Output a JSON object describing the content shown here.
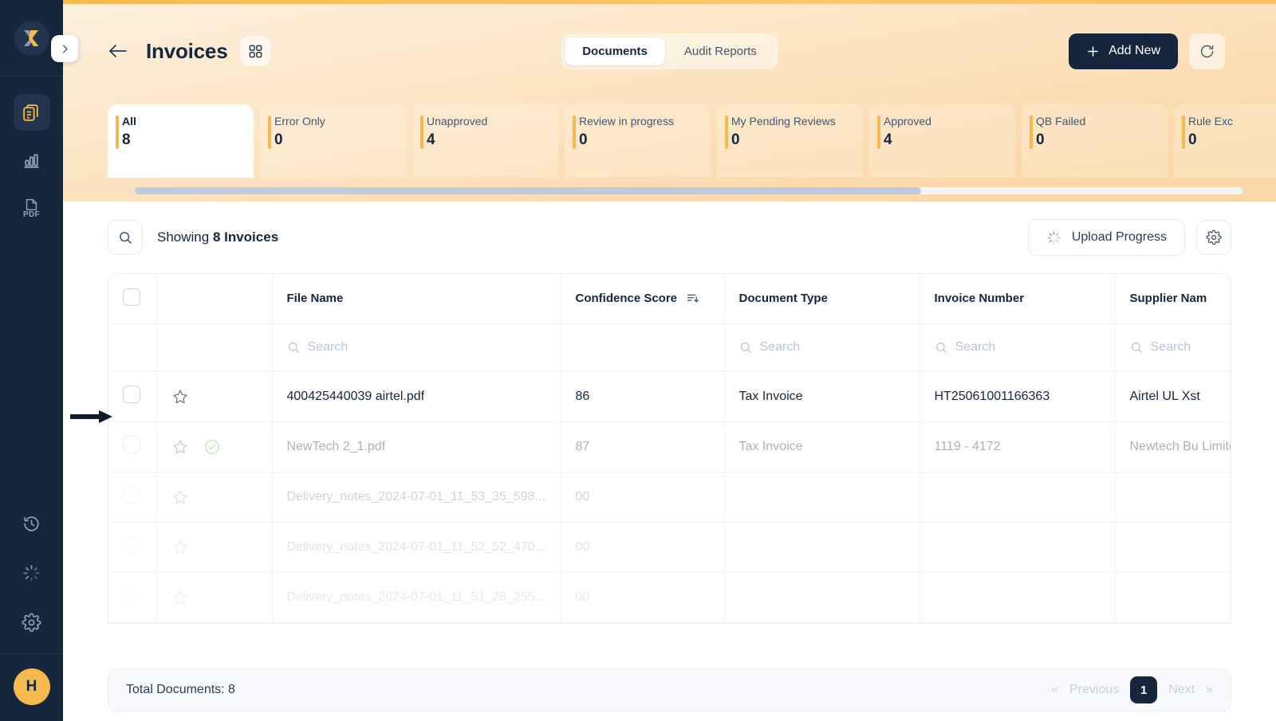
{
  "sidebar": {
    "logo_icon": "x-logo-icon",
    "collapse_icon": "chevron-right-icon",
    "items": [
      {
        "icon": "documents-icon",
        "name": "documents",
        "active": true
      },
      {
        "icon": "bar-chart-icon",
        "name": "analytics",
        "active": false
      },
      {
        "icon": "pdf-file-icon",
        "name": "pdf",
        "active": false,
        "label": "PDF"
      }
    ],
    "bottom_items": [
      {
        "icon": "history-clock-icon",
        "name": "history"
      },
      {
        "icon": "spinner-icon",
        "name": "processing"
      },
      {
        "icon": "gear-icon",
        "name": "settings"
      }
    ],
    "avatar_initial": "H"
  },
  "header": {
    "back_icon": "arrow-left-icon",
    "title": "Invoices",
    "grid_icon": "grid-view-icon",
    "tabs": [
      {
        "label": "Documents",
        "active": true
      },
      {
        "label": "Audit Reports",
        "active": false
      }
    ],
    "add_new_label": "Add New",
    "add_icon": "plus-icon",
    "refresh_icon": "refresh-icon"
  },
  "stats": [
    {
      "label": "All",
      "value": "8",
      "active": true
    },
    {
      "label": "Error Only",
      "value": "0",
      "active": false
    },
    {
      "label": "Unapproved",
      "value": "4",
      "active": false
    },
    {
      "label": "Review in progress",
      "value": "0",
      "active": false
    },
    {
      "label": "My Pending Reviews",
      "value": "0",
      "active": false
    },
    {
      "label": "Approved",
      "value": "4",
      "active": false
    },
    {
      "label": "QB Failed",
      "value": "0",
      "active": false
    },
    {
      "label": "Rule Exc",
      "value": "0",
      "active": false
    }
  ],
  "toolbar": {
    "search_icon": "search-icon",
    "showing_prefix": "Showing ",
    "showing_count": "8 Invoices",
    "upload_progress_label": "Upload Progress",
    "upload_icon": "spinner-icon",
    "settings_icon": "gear-icon"
  },
  "table": {
    "columns": [
      {
        "key": "checkbox",
        "label": ""
      },
      {
        "key": "star",
        "label": ""
      },
      {
        "key": "file_name",
        "label": "File Name",
        "searchable": true
      },
      {
        "key": "confidence_score",
        "label": "Confidence Score",
        "sortable": true,
        "searchable": false
      },
      {
        "key": "document_type",
        "label": "Document Type",
        "searchable": true
      },
      {
        "key": "invoice_number",
        "label": "Invoice Number",
        "searchable": true
      },
      {
        "key": "supplier_name",
        "label": "Supplier Nam",
        "searchable": true
      }
    ],
    "search_placeholder": "Search",
    "sort_icon": "sort-descending-icon",
    "rows": [
      {
        "file_name": "400425440039 airtel.pdf",
        "confidence_score": "86",
        "document_type": "Tax Invoice",
        "invoice_number": "HT25061001166363",
        "supplier_name": "Airtel UL Xst",
        "starred": false,
        "verified": false
      },
      {
        "file_name": "NewTech 2_1.pdf",
        "confidence_score": "87",
        "document_type": "Tax Invoice",
        "invoice_number": "1119 - 4172",
        "supplier_name": "Newtech Bu Limited",
        "starred": false,
        "verified": true
      },
      {
        "file_name": "Delivery_notes_2024-07-01_11_53_35_598...",
        "confidence_score": "00",
        "document_type": "",
        "invoice_number": "",
        "supplier_name": "",
        "starred": false,
        "verified": false
      },
      {
        "file_name": "Delivery_notes_2024-07-01_11_52_52_470...",
        "confidence_score": "00",
        "document_type": "",
        "invoice_number": "",
        "supplier_name": "",
        "starred": false,
        "verified": false
      },
      {
        "file_name": "Delivery_notes_2024-07-01_11_51_28_255...",
        "confidence_score": "00",
        "document_type": "",
        "invoice_number": "",
        "supplier_name": "",
        "starred": false,
        "verified": false
      }
    ]
  },
  "footer": {
    "total_documents": "Total Documents: 8",
    "previous_label": "Previous",
    "next_label": "Next",
    "current_page": "1",
    "prev_chevron": "«",
    "next_chevron": "»"
  },
  "annotation": {
    "pointer_icon": "right-arrow-pointer-icon",
    "target_row": 0
  },
  "colors": {
    "accent": "#f6b94e",
    "dark": "#16263c",
    "hero_start": "#fdf0dd",
    "hero_end": "#fad7a6",
    "success": "#6cbf4b"
  }
}
